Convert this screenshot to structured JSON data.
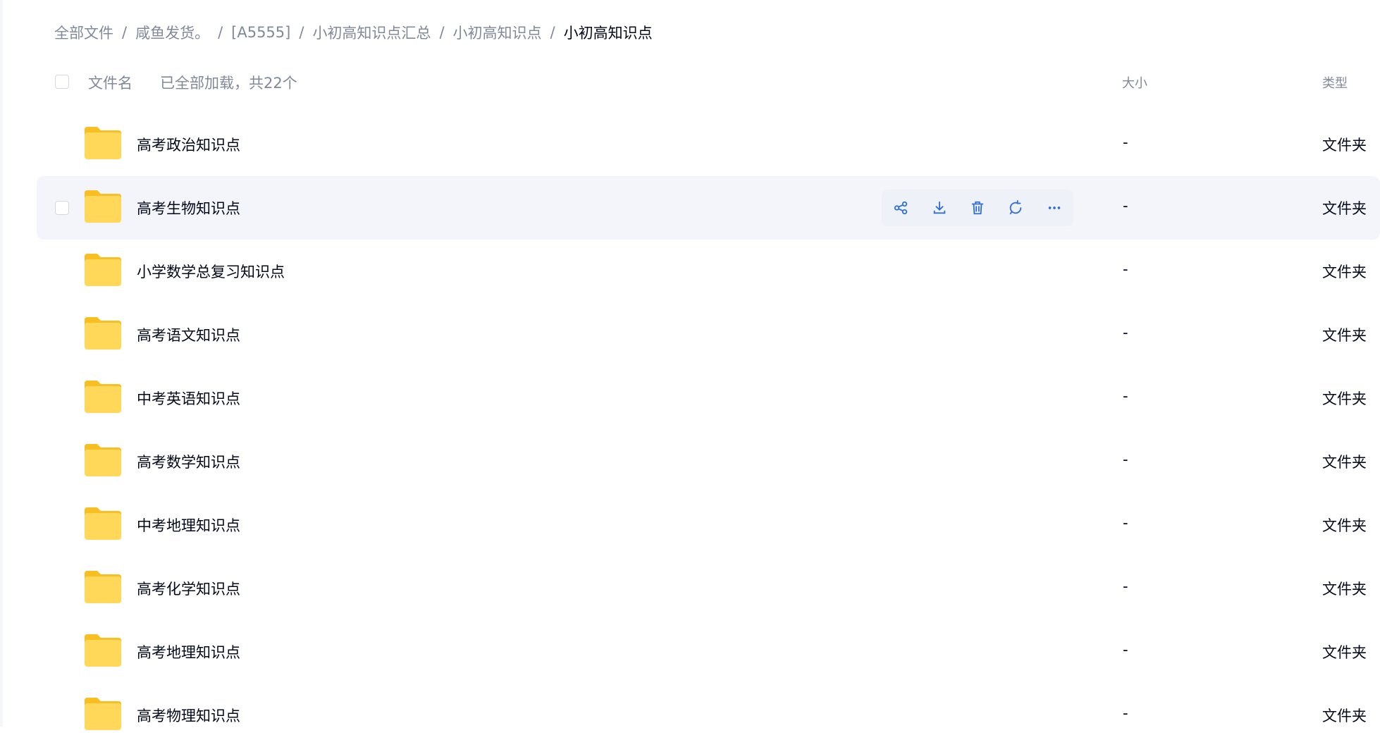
{
  "breadcrumb": {
    "items": [
      "全部文件",
      "咸鱼发货。",
      "[A5555]",
      "小初高知识点汇总",
      "小初高知识点"
    ],
    "current": "小初高知识点",
    "separator": "/"
  },
  "list_header": {
    "name_label": "文件名",
    "status_text": "已全部加载，共22个",
    "size_label": "大小",
    "type_label": "类型"
  },
  "files": [
    {
      "name": "高考政治知识点",
      "size": "-",
      "type": "文件夹"
    },
    {
      "name": "高考生物知识点",
      "size": "-",
      "type": "文件夹"
    },
    {
      "name": "小学数学总复习知识点",
      "size": "-",
      "type": "文件夹"
    },
    {
      "name": "高考语文知识点",
      "size": "-",
      "type": "文件夹"
    },
    {
      "name": "中考英语知识点",
      "size": "-",
      "type": "文件夹"
    },
    {
      "name": "高考数学知识点",
      "size": "-",
      "type": "文件夹"
    },
    {
      "name": "中考地理知识点",
      "size": "-",
      "type": "文件夹"
    },
    {
      "name": "高考化学知识点",
      "size": "-",
      "type": "文件夹"
    },
    {
      "name": "高考地理知识点",
      "size": "-",
      "type": "文件夹"
    },
    {
      "name": "高考物理知识点",
      "size": "-",
      "type": "文件夹"
    }
  ],
  "hovered_row_index": 1,
  "row_actions": [
    "share-icon",
    "download-icon",
    "trash-icon",
    "sync-icon",
    "more-icon"
  ],
  "colors": {
    "accent": "#2e6fd8",
    "folder_top": "#f8bf23",
    "folder_body": "#ffd85a",
    "muted_text": "#818999",
    "hover_row": "#f3f5fa"
  }
}
